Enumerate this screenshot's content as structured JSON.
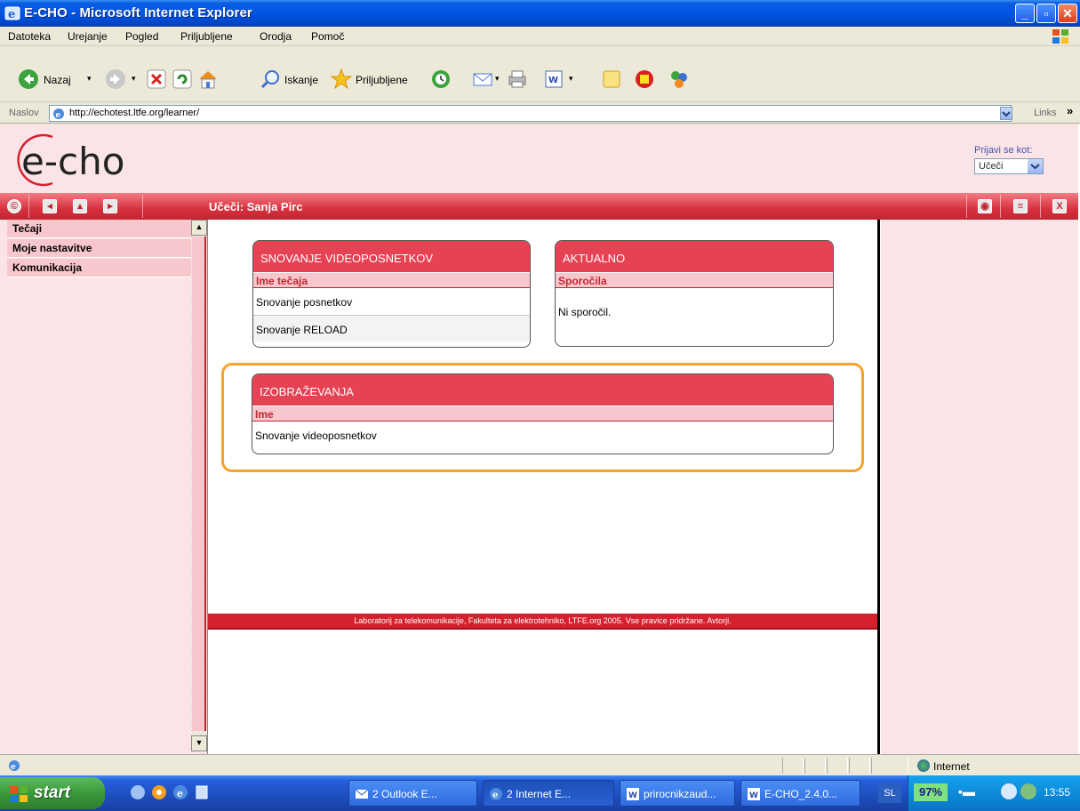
{
  "window": {
    "title": "E-CHO - Microsoft Internet Explorer"
  },
  "menu": [
    "Datoteka",
    "Urejanje",
    "Pogled",
    "Priljubljene",
    "Orodja",
    "Pomoč"
  ],
  "toolbar": {
    "back_label": "Nazaj",
    "search_label": "Iskanje",
    "favorites_label": "Priljubljene"
  },
  "address": {
    "label": "Naslov",
    "url": "http://echotest.ltfe.org/learner/",
    "links_label": "Links"
  },
  "echo": {
    "login_as_label": "Prijavi se kot:",
    "role_selected": "Učeči",
    "user_label": "Učeči: Sanja Pirc"
  },
  "sidebar": {
    "items": [
      {
        "label": "Tečaji"
      },
      {
        "label": "Moje nastavitve"
      },
      {
        "label": "Komunikacija"
      }
    ]
  },
  "panels": {
    "courses": {
      "title": "SNOVANJE VIDEOPOSNETKOV",
      "subheader": "Ime tečaja",
      "rows": [
        "Snovanje posnetkov",
        "Snovanje RELOAD"
      ]
    },
    "news": {
      "title": "AKTUALNO",
      "subheader": "Sporočila",
      "rows": [
        "Ni sporočil."
      ]
    },
    "training": {
      "title": "IZOBRAŽEVANJA",
      "subheader": "Ime",
      "rows": [
        "Snovanje videoposnetkov"
      ]
    }
  },
  "footer": {
    "text": "Laboratorij za telekomunikacije, Fakulteta za elektrotehniko, LTFE.org 2005. Vse pravice pridržane. Avtorji."
  },
  "statusbar": {
    "zone": "Internet"
  },
  "taskbar": {
    "start_label": "start",
    "tasks": [
      {
        "label": "2 Outlook E...",
        "icon": "outlook-icon"
      },
      {
        "label": "2 Internet E...",
        "icon": "ie-icon"
      },
      {
        "label": "prirocnikzaud...",
        "icon": "word-icon"
      },
      {
        "label": "E-CHO_2.4.0...",
        "icon": "word-icon"
      }
    ],
    "language": "SL",
    "battery": "97%",
    "clock": "13:55"
  },
  "colors": {
    "accent_red": "#e54253",
    "highlight_orange": "#f7a22c",
    "sidebar_pink": "#fbe4e8"
  }
}
